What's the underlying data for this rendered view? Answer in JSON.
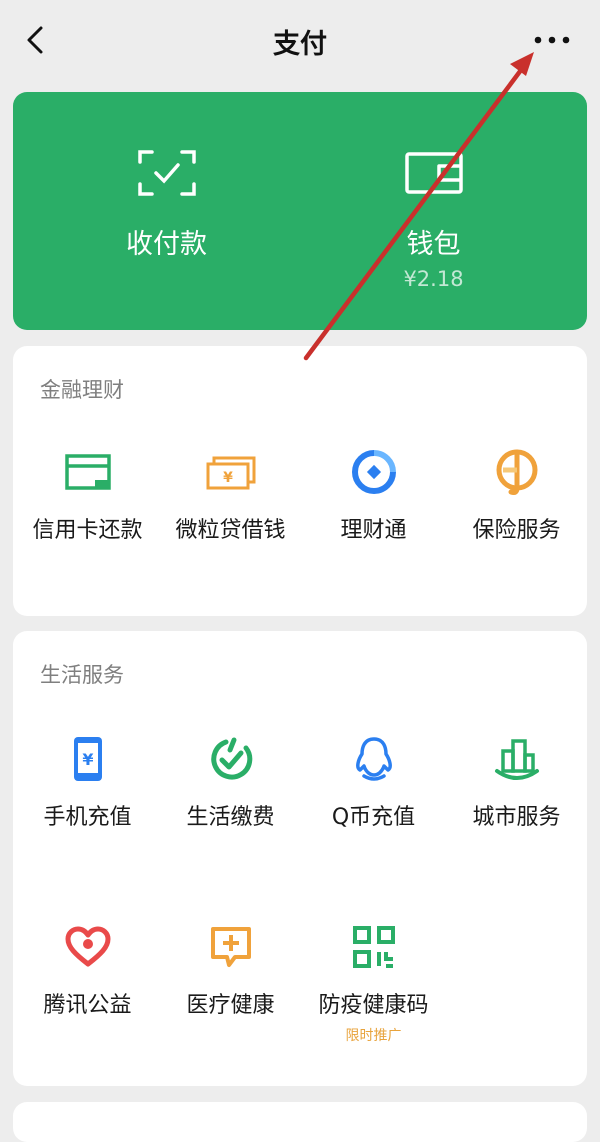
{
  "nav": {
    "title": "支付"
  },
  "hero": {
    "items": [
      {
        "label": "收付款",
        "icon": "scan-pay-icon"
      },
      {
        "label": "钱包",
        "sub": "¥2.18",
        "icon": "wallet-icon"
      }
    ],
    "color": "#2aae67"
  },
  "finance": {
    "title": "金融理财",
    "items": [
      {
        "label": "信用卡还款",
        "icon": "credit-card-icon"
      },
      {
        "label": "微粒贷借钱",
        "icon": "cash-icon"
      },
      {
        "label": "理财通",
        "icon": "wealth-icon"
      },
      {
        "label": "保险服务",
        "icon": "umbrella-icon"
      }
    ]
  },
  "life": {
    "title": "生活服务",
    "items": [
      {
        "label": "手机充值",
        "icon": "phone-topup-icon"
      },
      {
        "label": "生活缴费",
        "icon": "utility-bill-icon"
      },
      {
        "label": "Q币充值",
        "icon": "qq-penguin-icon"
      },
      {
        "label": "城市服务",
        "icon": "city-building-icon"
      },
      {
        "label": "腾讯公益",
        "icon": "charity-heart-icon"
      },
      {
        "label": "医疗健康",
        "icon": "medical-chat-icon"
      },
      {
        "label": "防疫健康码",
        "tag": "限时推广",
        "icon": "qr-code-icon"
      }
    ]
  },
  "colors": {
    "green": "#2aae67",
    "orange": "#f0a23b",
    "blue": "#2b7ff0",
    "red": "#e94a4a",
    "arrow": "#c9302c"
  }
}
